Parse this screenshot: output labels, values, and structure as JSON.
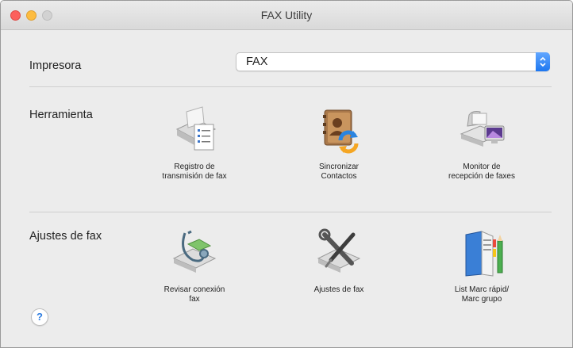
{
  "window": {
    "title": "FAX Utility"
  },
  "printer": {
    "label": "Impresora",
    "selected": "FAX"
  },
  "tools": {
    "label": "Herramienta",
    "items": [
      {
        "label": "Registro de\ntransmisión de fax",
        "icon": "fax-log-icon"
      },
      {
        "label": "Sincronizar\nContactos",
        "icon": "sync-contacts-icon"
      },
      {
        "label": "Monitor de\nrecepción de faxes",
        "icon": "fax-monitor-icon"
      }
    ]
  },
  "fax_settings": {
    "label": "Ajustes de fax",
    "items": [
      {
        "label": "Revisar conexión\nfax",
        "icon": "check-connection-icon"
      },
      {
        "label": "Ajustes de fax",
        "icon": "fax-settings-icon"
      },
      {
        "label": "List Marc rápid/\nMarc grupo",
        "icon": "speed-dial-list-icon"
      }
    ]
  },
  "help": {
    "label": "?"
  }
}
